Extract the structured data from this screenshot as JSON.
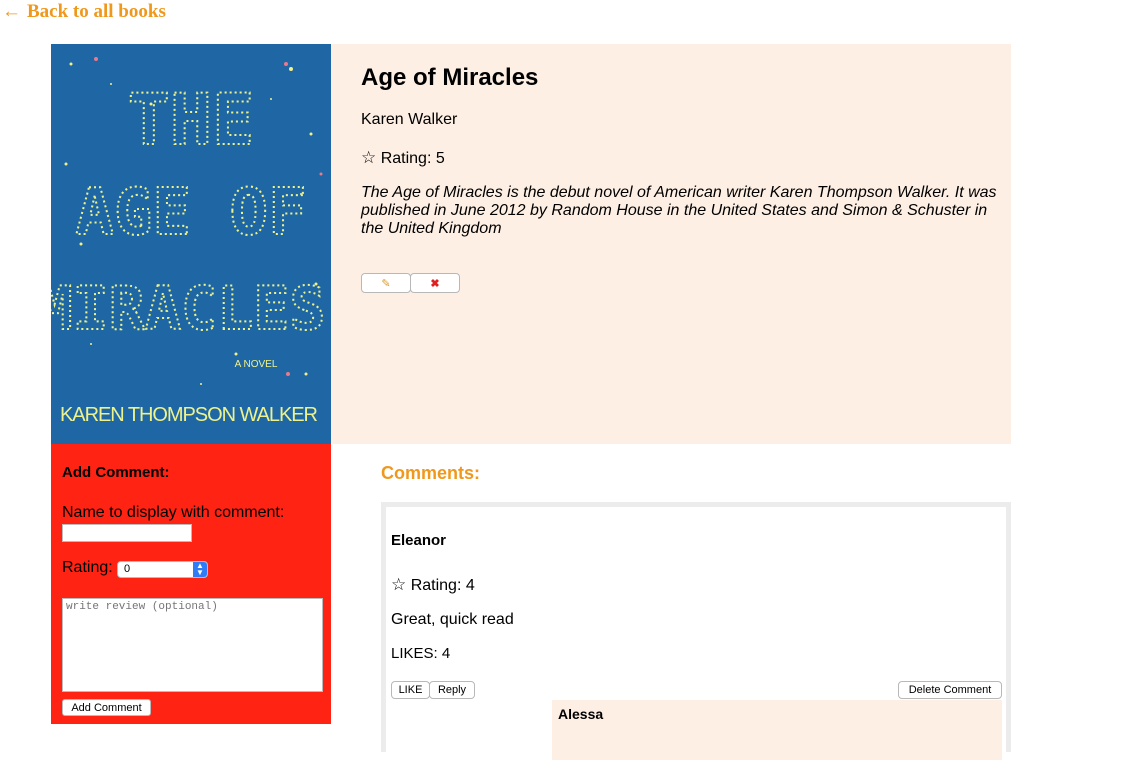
{
  "nav": {
    "back_arrow": "←",
    "back_label": "Back to all books"
  },
  "cover": {
    "title_line1": "THE",
    "title_line2": "AGE OF",
    "title_line3": "MIRACLES",
    "subtitle": "A NOVEL",
    "author": "KAREN THOMPSON WALKER",
    "background_color": "#1e67a4"
  },
  "book": {
    "title": "Age of Miracles",
    "author": "Karen Walker",
    "star": "☆",
    "rating_label": "Rating: 5",
    "description": "The Age of Miracles is the debut novel of American writer Karen Thompson Walker. It was published in June 2012 by Random House in the United States and Simon & Schuster in the United Kingdom",
    "edit_icon": "✎",
    "delete_icon": "✖"
  },
  "add_comment": {
    "heading": "Add Comment:",
    "name_label": "Name to display with comment:",
    "name_value": "",
    "rating_label": "Rating:",
    "rating_value": "0",
    "review_placeholder": "write review (optional)",
    "submit_label": "Add Comment",
    "background_color": "#fe2312"
  },
  "comments": {
    "heading": "Comments:",
    "items": [
      {
        "author": "Eleanor",
        "star": "☆",
        "rating_label": "Rating: 4",
        "text": "Great, quick read",
        "likes_label": "LIKES: 4",
        "like_button": "LIKE",
        "reply_button": "Reply",
        "delete_button": "Delete Comment",
        "replies": [
          {
            "author": "Alessa"
          }
        ]
      }
    ]
  },
  "colors": {
    "accent": "#f0981c",
    "details_bg": "#fdefe4"
  }
}
